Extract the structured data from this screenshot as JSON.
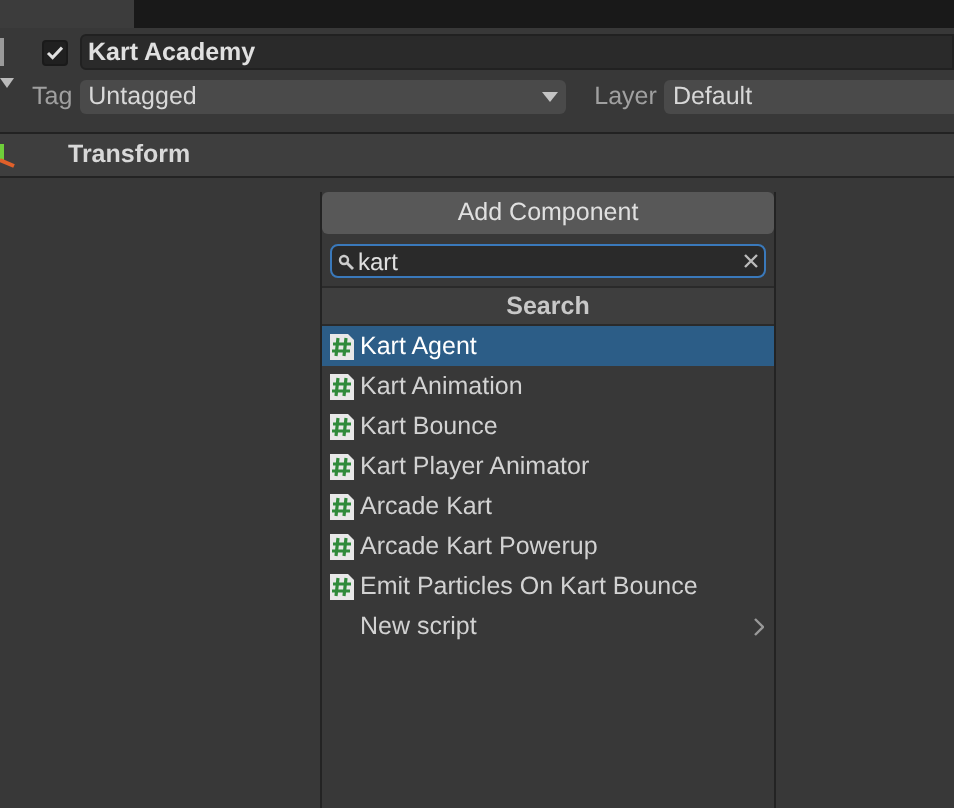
{
  "game_object": {
    "active": true,
    "name": "Kart Academy",
    "tag_label": "Tag",
    "tag": "Untagged",
    "layer_label": "Layer",
    "layer": "Default"
  },
  "components": [
    {
      "name": "Transform"
    }
  ],
  "add_component": {
    "button": "Add Component",
    "search": {
      "value": "kart"
    },
    "header": "Search",
    "items": [
      {
        "kind": "script",
        "label": "Kart Agent",
        "selected": true
      },
      {
        "kind": "script",
        "label": "Kart Animation",
        "selected": false
      },
      {
        "kind": "script",
        "label": "Kart Bounce",
        "selected": false
      },
      {
        "kind": "script",
        "label": "Kart Player Animator",
        "selected": false
      },
      {
        "kind": "script",
        "label": "Arcade Kart",
        "selected": false
      },
      {
        "kind": "script",
        "label": "Arcade Kart Powerup",
        "selected": false
      },
      {
        "kind": "script",
        "label": "Emit Particles On Kart Bounce",
        "selected": false
      },
      {
        "kind": "submenu",
        "label": "New script",
        "selected": false
      }
    ]
  }
}
